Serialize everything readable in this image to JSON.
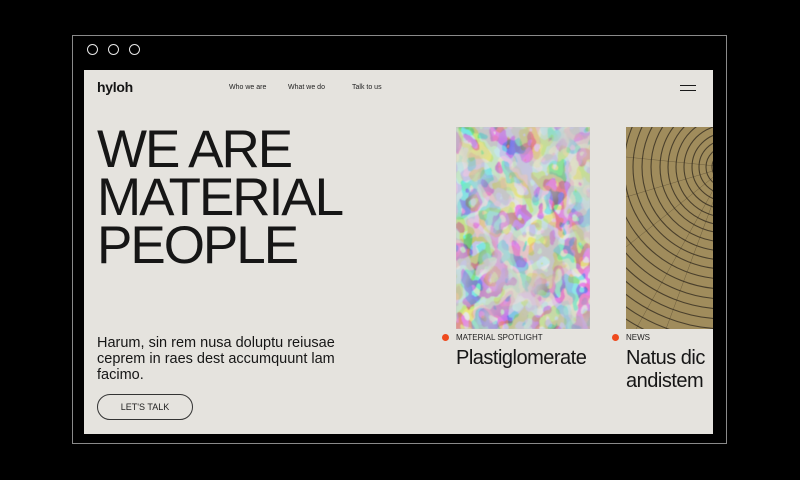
{
  "brand": {
    "logo": "hyloh"
  },
  "nav": {
    "items": [
      "Who we are",
      "What we do",
      "Talk to us"
    ]
  },
  "hero": {
    "lines": [
      "WE ARE",
      "MATERIAL",
      "PEOPLE"
    ]
  },
  "intro": {
    "text": "Harum, sin rem nusa doluptu reiusae ceprem in raes dest accumquunt lam facimo."
  },
  "cta": {
    "label": "LET'S TALK"
  },
  "cards": [
    {
      "tag": "MATERIAL SPOTLIGHT",
      "title_lines": [
        "Plastiglomerate"
      ],
      "image": "marbled-plastic-texture"
    },
    {
      "tag": "NEWS",
      "title_lines": [
        "Natus dic",
        "andistem"
      ],
      "image": "wood-rings-texture"
    }
  ],
  "icons": {
    "menu": "hamburger-menu-icon",
    "window_controls": [
      "circle-icon",
      "circle-icon",
      "circle-icon"
    ]
  },
  "colors": {
    "accent": "#ef4a1d",
    "page_bg": "#e5e3de",
    "text": "#161616",
    "frame_bg": "#000000"
  }
}
